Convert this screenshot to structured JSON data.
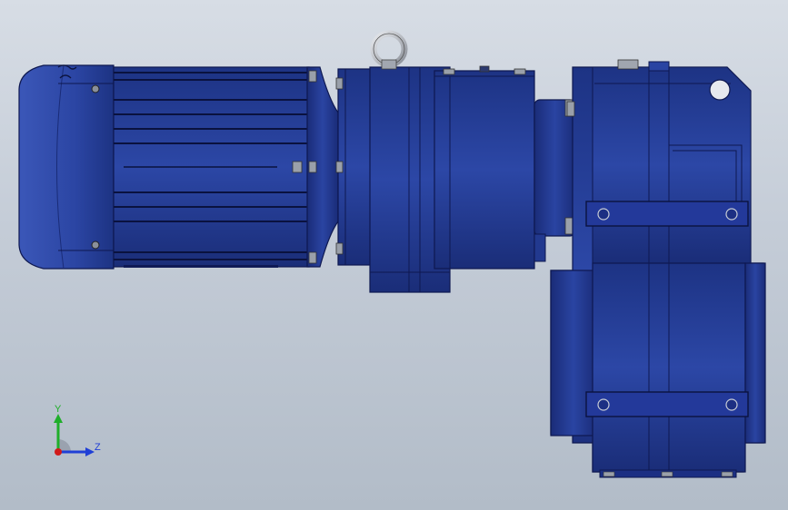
{
  "viewport": {
    "background_top": "#d7dde5",
    "background_bottom": "#b2bcc8"
  },
  "model": {
    "part_color": "#27409a",
    "part_color_dark": "#14246a",
    "part_color_light": "#3a55b5",
    "hardware_color": "#9aa0aa"
  },
  "triad": {
    "y_label": "Y",
    "z_label": "Z",
    "y_color": "#1fae2a",
    "z_color": "#1f3fd6",
    "x_color": "#d11a1a"
  }
}
